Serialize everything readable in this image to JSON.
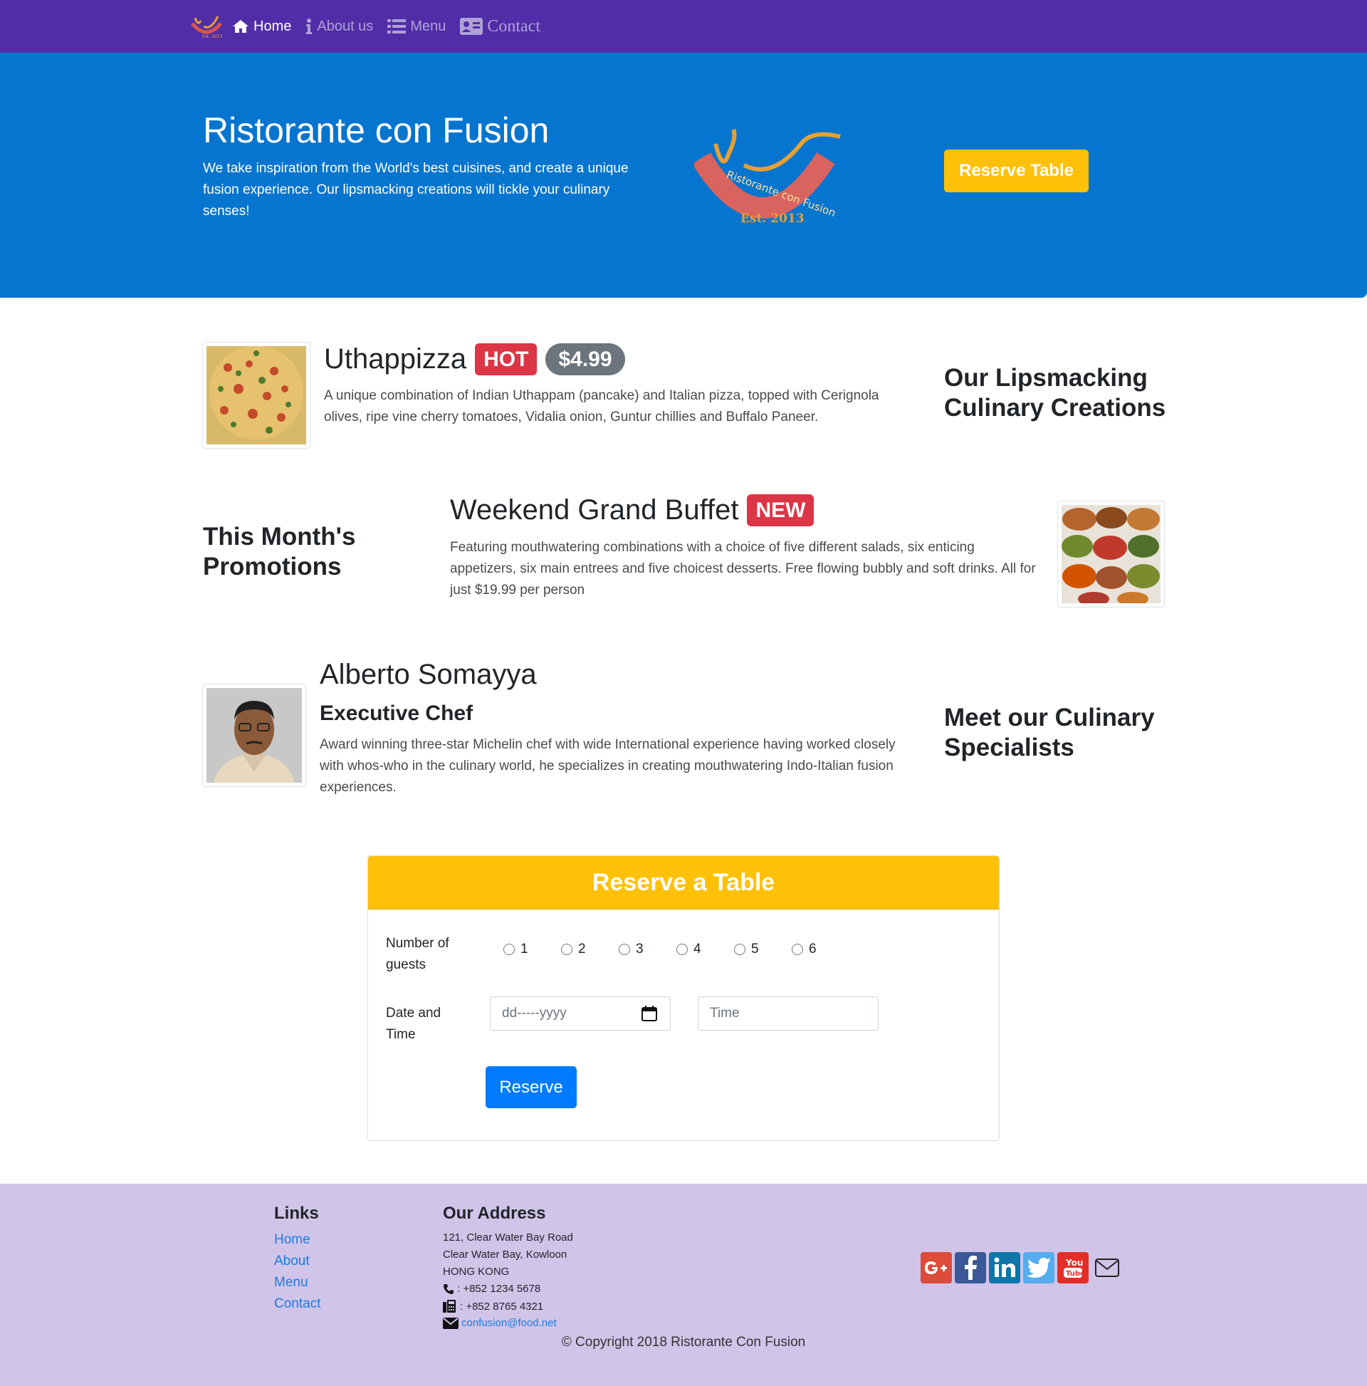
{
  "nav": {
    "logo_icon": "restaurant-logo",
    "items": [
      {
        "label": "Home",
        "icon": "home-icon"
      },
      {
        "label": "About us",
        "icon": "info-icon"
      },
      {
        "label": "Menu",
        "icon": "list-icon"
      },
      {
        "label": "Contact",
        "icon": "address-card-icon"
      }
    ],
    "colors": {
      "background": "#512DA8",
      "active": "#ffffff"
    }
  },
  "jumbotron": {
    "title": "Ristorante con Fusion",
    "text": "We take inspiration from the World's best cuisines, and create a unique fusion experience. Our lipsmacking creations will tickle your culinary senses!",
    "logo_text": "Ristorante con Fusion",
    "logo_est": "Est. 2013",
    "button": "Reserve Table",
    "colors": {
      "background": "#0675CF",
      "button": "#FFC107"
    }
  },
  "dish": {
    "title": "Uthappizza",
    "badge": "HOT",
    "price": "$4.99",
    "text": "A unique combination of Indian Uthappam (pancake) and Italian pizza, topped with Cerignola olives, ripe vine cherry tomatoes, Vidalia onion, Guntur chillies and Buffalo Paneer.",
    "side_heading": "Our Lipsmacking Culinary Creations"
  },
  "promotion": {
    "side_heading": "This Month's Promotions",
    "title": "Weekend Grand Buffet",
    "badge": "NEW",
    "text": "Featuring mouthwatering combinations with a choice of five different salads, six enticing appetizers, six main entrees and five choicest desserts. Free flowing bubbly and soft drinks. All for just $19.99 per person"
  },
  "leader": {
    "name": "Alberto Somayya",
    "designation": "Executive Chef",
    "text": "Award winning three-star Michelin chef with wide International experience having worked closely with whos-who in the culinary world, he specializes in creating mouthwatering Indo-Italian fusion experiences.",
    "side_heading": "Meet our Culinary Specialists"
  },
  "reserve": {
    "header": "Reserve a Table",
    "guests_label": "Number of guests",
    "guest_options": [
      "1",
      "2",
      "3",
      "4",
      "5",
      "6"
    ],
    "datetime_label": "Date and Time",
    "date_placeholder": "dd-----yyyy",
    "time_placeholder": "Time",
    "submit": "Reserve",
    "colors": {
      "header": "#FFC107",
      "submit": "#007bff"
    }
  },
  "footer": {
    "links_heading": "Links",
    "links": [
      "Home",
      "About",
      "Menu",
      "Contact"
    ],
    "address_heading": "Our Address",
    "address_lines": [
      "121, Clear Water Bay Road",
      "Clear Water Bay, Kowloon",
      "HONG KONG"
    ],
    "phone": ": +852 1234 5678",
    "fax": ": +852 8765 4321",
    "email": "confusion@food.net",
    "social": [
      "google-plus-icon",
      "facebook-icon",
      "linkedin-icon",
      "twitter-icon",
      "youtube-icon",
      "envelope-icon"
    ],
    "copyright": "© Copyright 2018 Ristorante Con Fusion",
    "colors": {
      "background": "#D1C4E9"
    }
  }
}
